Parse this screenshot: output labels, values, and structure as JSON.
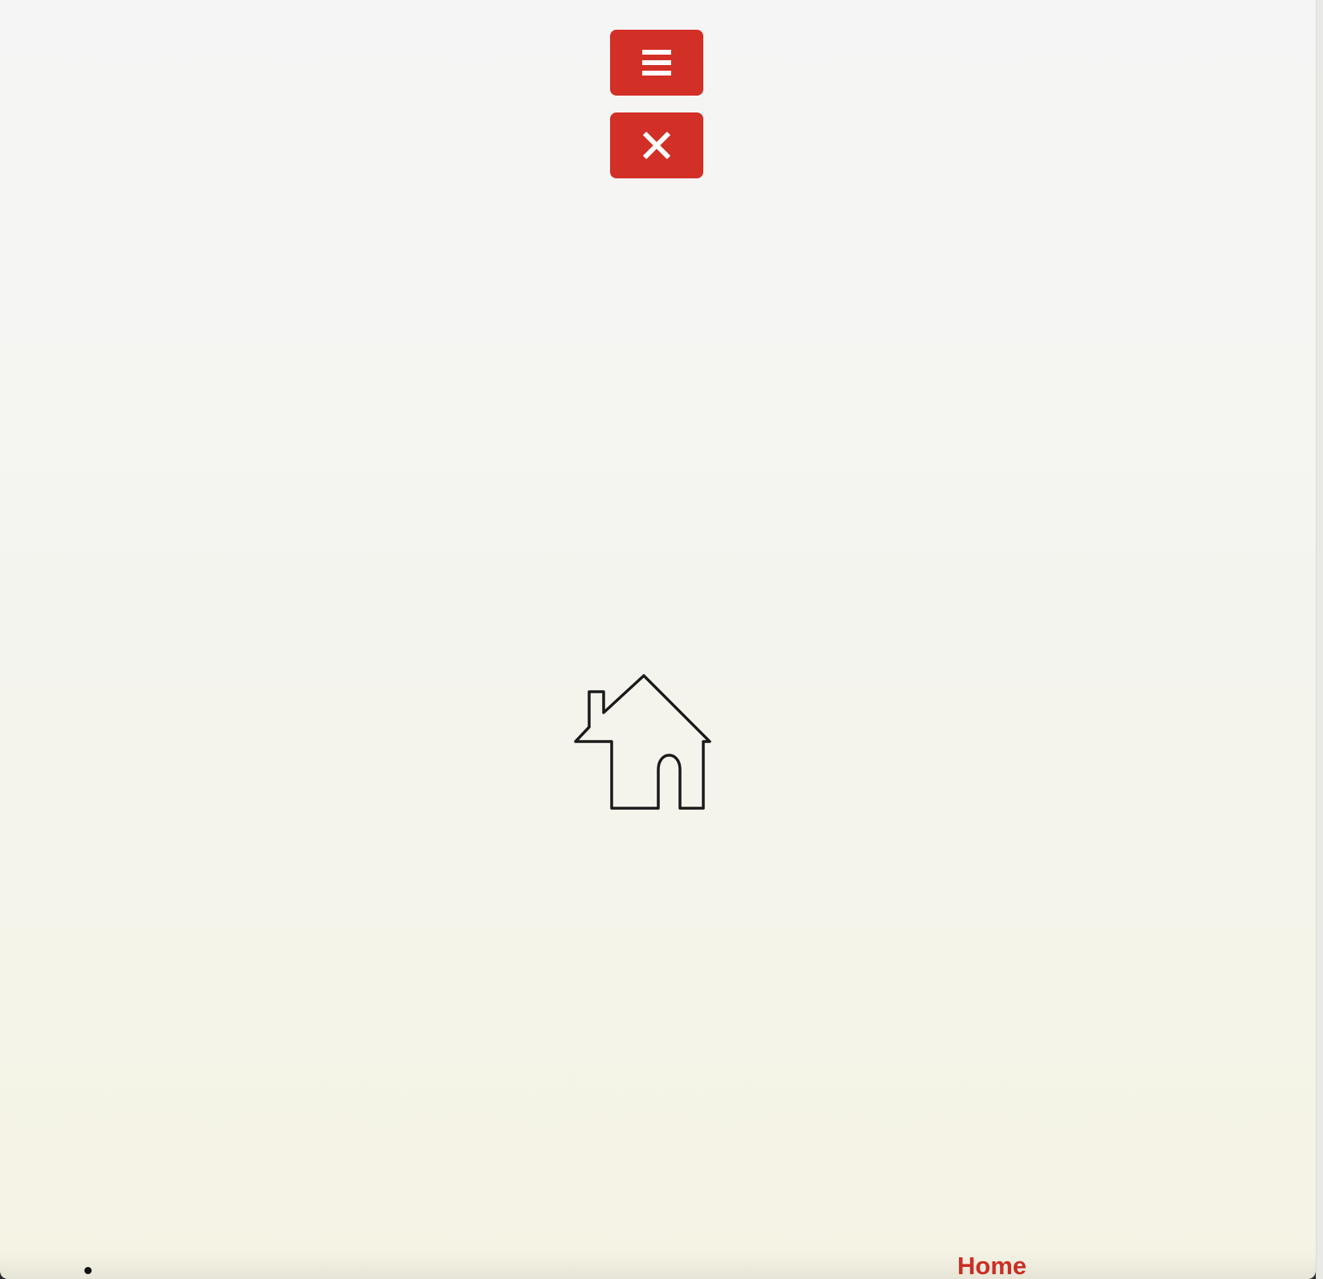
{
  "colors": {
    "accent": "#d22f26",
    "icon_light": "#ffffff",
    "logo_stroke": "#1a1a1a"
  },
  "header": {
    "open_menu_icon": "hamburger-menu-icon",
    "close_menu_icon": "close-icon"
  },
  "main": {
    "logo_icon": "house-icon"
  },
  "nav": {
    "items": [
      {
        "label": "Home"
      }
    ]
  }
}
